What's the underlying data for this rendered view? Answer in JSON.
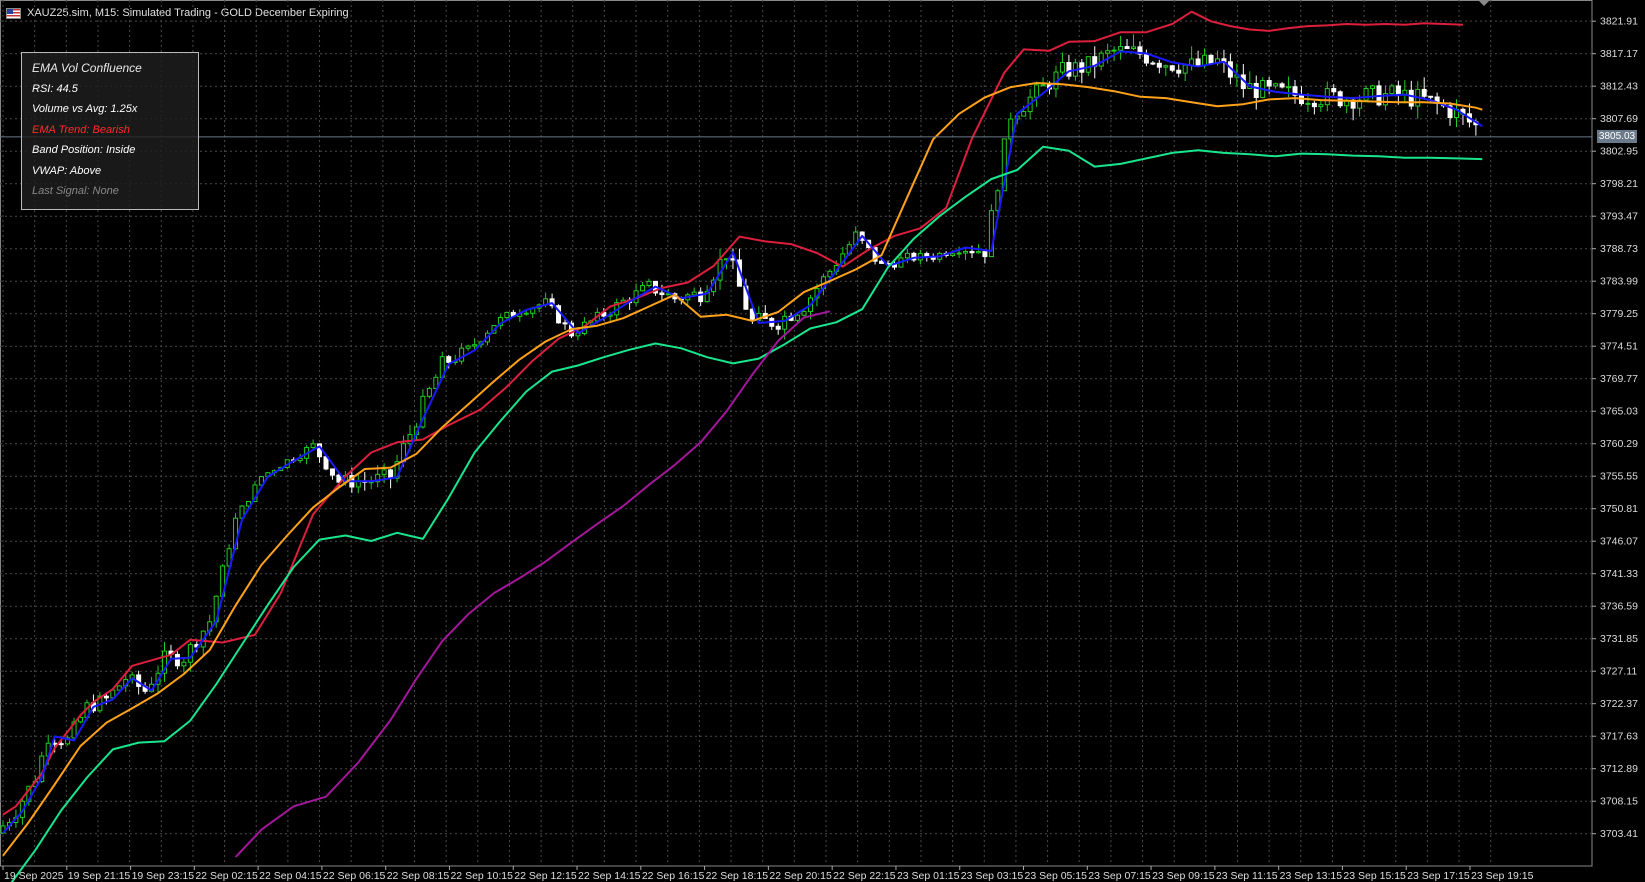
{
  "window": {
    "title": "XAUZ25.sim, M15:  Simulated Trading - GOLD December Expiring"
  },
  "colors": {
    "background": "#000000",
    "grid": "#4a4a4a",
    "bull_candle": "#22cc22",
    "bear_candle": "#ffffff",
    "ema_fast": "#1a1aff",
    "upper_band": "#dc1f3c",
    "ema_slow": "#ffa21a",
    "lower_band": "#19e68c",
    "vwap": "#a3179a",
    "bearish_text": "#ff2a2a",
    "muted_text": "#888888"
  },
  "info_panel": {
    "title": "EMA Vol Confluence",
    "rsi": "RSI: 44.5",
    "volume": "Volume vs Avg: 1.25x",
    "trend": "EMA Trend: Bearish",
    "band": "Band Position: Inside",
    "vwap": "VWAP: Above",
    "signal": "Last Signal: None"
  },
  "chart_data": {
    "type": "line",
    "symbol": "XAUZ25.sim",
    "timeframe": "M15",
    "y_ticks": [
      "3821.91",
      "3817.17",
      "3812.43",
      "3807.69",
      "3802.95",
      "3798.21",
      "3793.47",
      "3788.73",
      "3783.99",
      "3779.25",
      "3774.51",
      "3769.77",
      "3765.03",
      "3760.29",
      "3755.55",
      "3750.81",
      "3746.07",
      "3741.33",
      "3736.59",
      "3731.85",
      "3727.11",
      "3722.37",
      "3717.63",
      "3712.89",
      "3708.15",
      "3703.41"
    ],
    "ylim": [
      3698.7,
      3825.0
    ],
    "x_ticks": [
      "19 Sep 2025",
      "19 Sep 21:15",
      "19 Sep 23:15",
      "22 Sep 02:15",
      "22 Sep 04:15",
      "22 Sep 06:15",
      "22 Sep 08:15",
      "22 Sep 10:15",
      "22 Sep 12:15",
      "22 Sep 14:15",
      "22 Sep 16:15",
      "22 Sep 18:15",
      "22 Sep 20:15",
      "22 Sep 22:15",
      "23 Sep 01:15",
      "23 Sep 03:15",
      "23 Sep 05:15",
      "23 Sep 07:15",
      "23 Sep 09:15",
      "23 Sep 11:15",
      "23 Sep 13:15",
      "23 Sep 15:15",
      "23 Sep 17:15",
      "23 Sep 19:15"
    ],
    "current_price": "3805.03",
    "current_price_value": 3805.03,
    "series": [
      {
        "key": "upper",
        "color": "#dc1f3c",
        "t": [
          0,
          2,
          6,
          8,
          12,
          14,
          17,
          20,
          26,
          29,
          34,
          39,
          43,
          48,
          53,
          57,
          61,
          65,
          69,
          74,
          78,
          82,
          86,
          90,
          94,
          98,
          102,
          106,
          110,
          114,
          118,
          122,
          126,
          130,
          134,
          138,
          142,
          146,
          150,
          155,
          158,
          162,
          165,
          169,
          173,
          177,
          181,
          184,
          187,
          190,
          193,
          196,
          199,
          202,
          205,
          208,
          211,
          214,
          217,
          220,
          223,
          226
        ],
        "v": [
          3706.2,
          3707.4,
          3712.2,
          3715.9,
          3720.7,
          3722.6,
          3724.5,
          3727.9,
          3729.5,
          3731.7,
          3731.3,
          3732.4,
          3738.5,
          3750.0,
          3755.5,
          3759.0,
          3760.5,
          3760.9,
          3763.0,
          3765.3,
          3768.6,
          3772.4,
          3775.6,
          3777.4,
          3780.3,
          3781.5,
          3783.0,
          3783.8,
          3786.2,
          3790.5,
          3789.8,
          3789.4,
          3788.1,
          3786.1,
          3788.6,
          3790.6,
          3791.7,
          3794.7,
          3804.8,
          3814.4,
          3817.8,
          3817.6,
          3818.9,
          3819.0,
          3820.3,
          3820.3,
          3821.5,
          3823.3,
          3821.9,
          3821.2,
          3820.7,
          3820.5,
          3820.9,
          3821.2,
          3821.3,
          3821.5,
          3821.4,
          3821.5,
          3821.4,
          3821.6,
          3821.5,
          3821.4
        ]
      },
      {
        "key": "ema_fast",
        "color": "#1a1aff",
        "t": [
          0,
          3,
          6,
          8,
          11,
          14,
          17,
          20,
          23,
          26,
          29,
          33,
          37,
          41,
          45,
          49,
          53,
          57,
          61,
          65,
          69,
          73,
          77,
          81,
          85,
          89,
          93,
          97,
          101,
          105,
          109,
          113,
          117,
          121,
          125,
          129,
          133,
          137,
          141,
          145,
          149,
          153,
          157,
          161,
          165,
          169,
          173,
          177,
          181,
          185,
          189,
          193,
          197,
          201,
          205,
          209,
          213,
          217,
          221,
          225,
          229
        ],
        "v": [
          3703.5,
          3706.7,
          3711.6,
          3717.6,
          3717.0,
          3721.9,
          3723.0,
          3726.1,
          3724.3,
          3728.9,
          3729.1,
          3734.4,
          3749.2,
          3755.5,
          3757.8,
          3759.9,
          3754.8,
          3754.8,
          3755.4,
          3763.9,
          3771.9,
          3773.9,
          3777.8,
          3779.8,
          3780.8,
          3776.4,
          3778.6,
          3781.0,
          3783.2,
          3781.5,
          3782.2,
          3788.2,
          3777.9,
          3778.2,
          3780.5,
          3785.5,
          3790.6,
          3786.2,
          3787.4,
          3787.6,
          3788.9,
          3788.4,
          3808.4,
          3811.4,
          3814.6,
          3815.4,
          3817.5,
          3817.2,
          3815.9,
          3815.3,
          3816.0,
          3812.4,
          3811.6,
          3811.2,
          3810.9,
          3810.7,
          3811.0,
          3811.2,
          3810.4,
          3809.0,
          3806.6
        ]
      },
      {
        "key": "ema_slow",
        "color": "#ffa21a",
        "t": [
          0,
          4,
          8,
          12,
          16,
          20,
          24,
          28,
          32,
          36,
          40,
          44,
          48,
          52,
          56,
          60,
          64,
          68,
          72,
          76,
          80,
          84,
          88,
          92,
          96,
          100,
          104,
          108,
          112,
          116,
          120,
          124,
          128,
          132,
          136,
          140,
          144,
          148,
          152,
          156,
          160,
          164,
          168,
          172,
          176,
          180,
          184,
          188,
          192,
          196,
          200,
          204,
          208,
          212,
          216,
          220,
          224,
          228,
          229
        ],
        "v": [
          3700.2,
          3705.1,
          3710.6,
          3716.2,
          3719.6,
          3721.7,
          3723.9,
          3726.7,
          3730.2,
          3736.7,
          3742.6,
          3746.9,
          3751.0,
          3753.9,
          3756.6,
          3756.8,
          3758.8,
          3762.7,
          3766.0,
          3769.4,
          3772.6,
          3775.2,
          3777.0,
          3777.5,
          3778.6,
          3780.3,
          3782.0,
          3778.8,
          3779.1,
          3778.2,
          3779.5,
          3782.4,
          3784.0,
          3785.7,
          3787.8,
          3796.3,
          3804.7,
          3808.4,
          3810.8,
          3812.3,
          3812.9,
          3812.7,
          3812.3,
          3811.7,
          3810.9,
          3810.7,
          3810.1,
          3809.5,
          3809.8,
          3810.5,
          3810.7,
          3810.4,
          3810.3,
          3810.2,
          3810.1,
          3810.1,
          3809.9,
          3809.3,
          3809.0
        ]
      },
      {
        "key": "lower",
        "color": "#19e68c",
        "t": [
          0,
          5,
          9,
          13,
          17,
          21,
          25,
          29,
          33,
          37,
          41,
          45,
          49,
          53,
          57,
          61,
          65,
          69,
          73,
          77,
          81,
          85,
          89,
          93,
          97,
          101,
          105,
          109,
          113,
          117,
          121,
          125,
          129,
          133,
          137,
          141,
          145,
          149,
          153,
          157,
          161,
          165,
          169,
          173,
          177,
          181,
          185,
          189,
          193,
          197,
          201,
          205,
          209,
          213,
          217,
          221,
          225,
          229
        ],
        "v": [
          3694.6,
          3701.0,
          3706.8,
          3711.6,
          3715.7,
          3716.7,
          3716.9,
          3719.9,
          3725.2,
          3731.0,
          3736.8,
          3742.3,
          3746.3,
          3746.9,
          3746.1,
          3747.3,
          3746.4,
          3752.4,
          3759.0,
          3763.6,
          3767.9,
          3770.8,
          3771.7,
          3772.9,
          3774.0,
          3774.9,
          3774.2,
          3772.9,
          3772.0,
          3772.7,
          3774.8,
          3777.1,
          3778.0,
          3779.9,
          3786.0,
          3790.2,
          3793.5,
          3796.3,
          3798.9,
          3800.2,
          3803.6,
          3803.0,
          3800.7,
          3801.1,
          3801.9,
          3802.7,
          3803.1,
          3802.7,
          3802.5,
          3802.2,
          3802.6,
          3802.5,
          3802.3,
          3802.2,
          3802.0,
          3802.0,
          3801.9,
          3801.8
        ]
      },
      {
        "key": "vwap",
        "color": "#a3179a",
        "t": [
          36,
          40,
          45,
          50,
          55,
          60,
          64,
          68,
          72,
          76,
          80,
          84,
          88,
          92,
          96,
          100,
          104,
          108,
          112,
          116,
          120,
          124,
          128
        ],
        "v": [
          3700.0,
          3704.0,
          3707.4,
          3708.8,
          3713.8,
          3720.0,
          3726.0,
          3731.5,
          3735.4,
          3738.5,
          3740.7,
          3743.1,
          3745.9,
          3748.6,
          3751.2,
          3754.3,
          3757.2,
          3760.5,
          3765.0,
          3770.4,
          3775.3,
          3778.7,
          3779.6
        ]
      }
    ]
  }
}
